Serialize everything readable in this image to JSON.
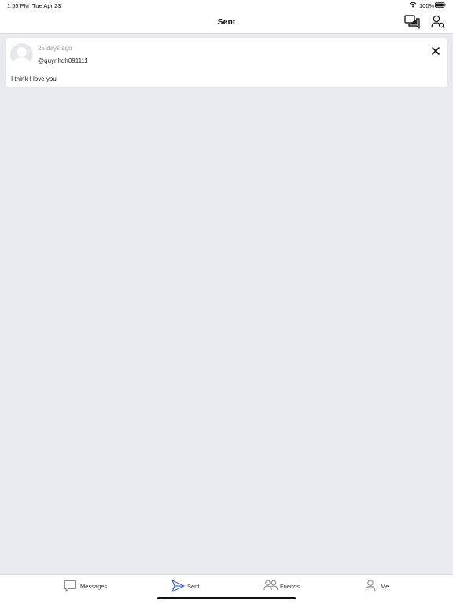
{
  "status": {
    "time": "1:55 PM",
    "date": "Tue Apr 23",
    "battery": "100%",
    "icons": [
      "wifi-icon",
      "battery-icon"
    ]
  },
  "header": {
    "title": "Sent",
    "icons": [
      "chat-bubbles-icon",
      "user-search-icon"
    ]
  },
  "sent_items": [
    {
      "time_ago": "25 days ago",
      "username": "@quynhdh091111",
      "text": "I think I love you",
      "icons": [
        "avatar-placeholder-icon",
        "close-icon"
      ]
    }
  ],
  "tabs": [
    {
      "label": "Messages",
      "icon": "message-icon",
      "active": false
    },
    {
      "label": "Sent",
      "icon": "send-icon",
      "active": true
    },
    {
      "label": "Friends",
      "icon": "friends-icon",
      "active": false
    },
    {
      "label": "Me",
      "icon": "user-icon",
      "active": false
    }
  ],
  "colors": {
    "background": "#e9eaee",
    "active_tab": "#3d63d8",
    "inactive_tab": "#8a8b90"
  }
}
